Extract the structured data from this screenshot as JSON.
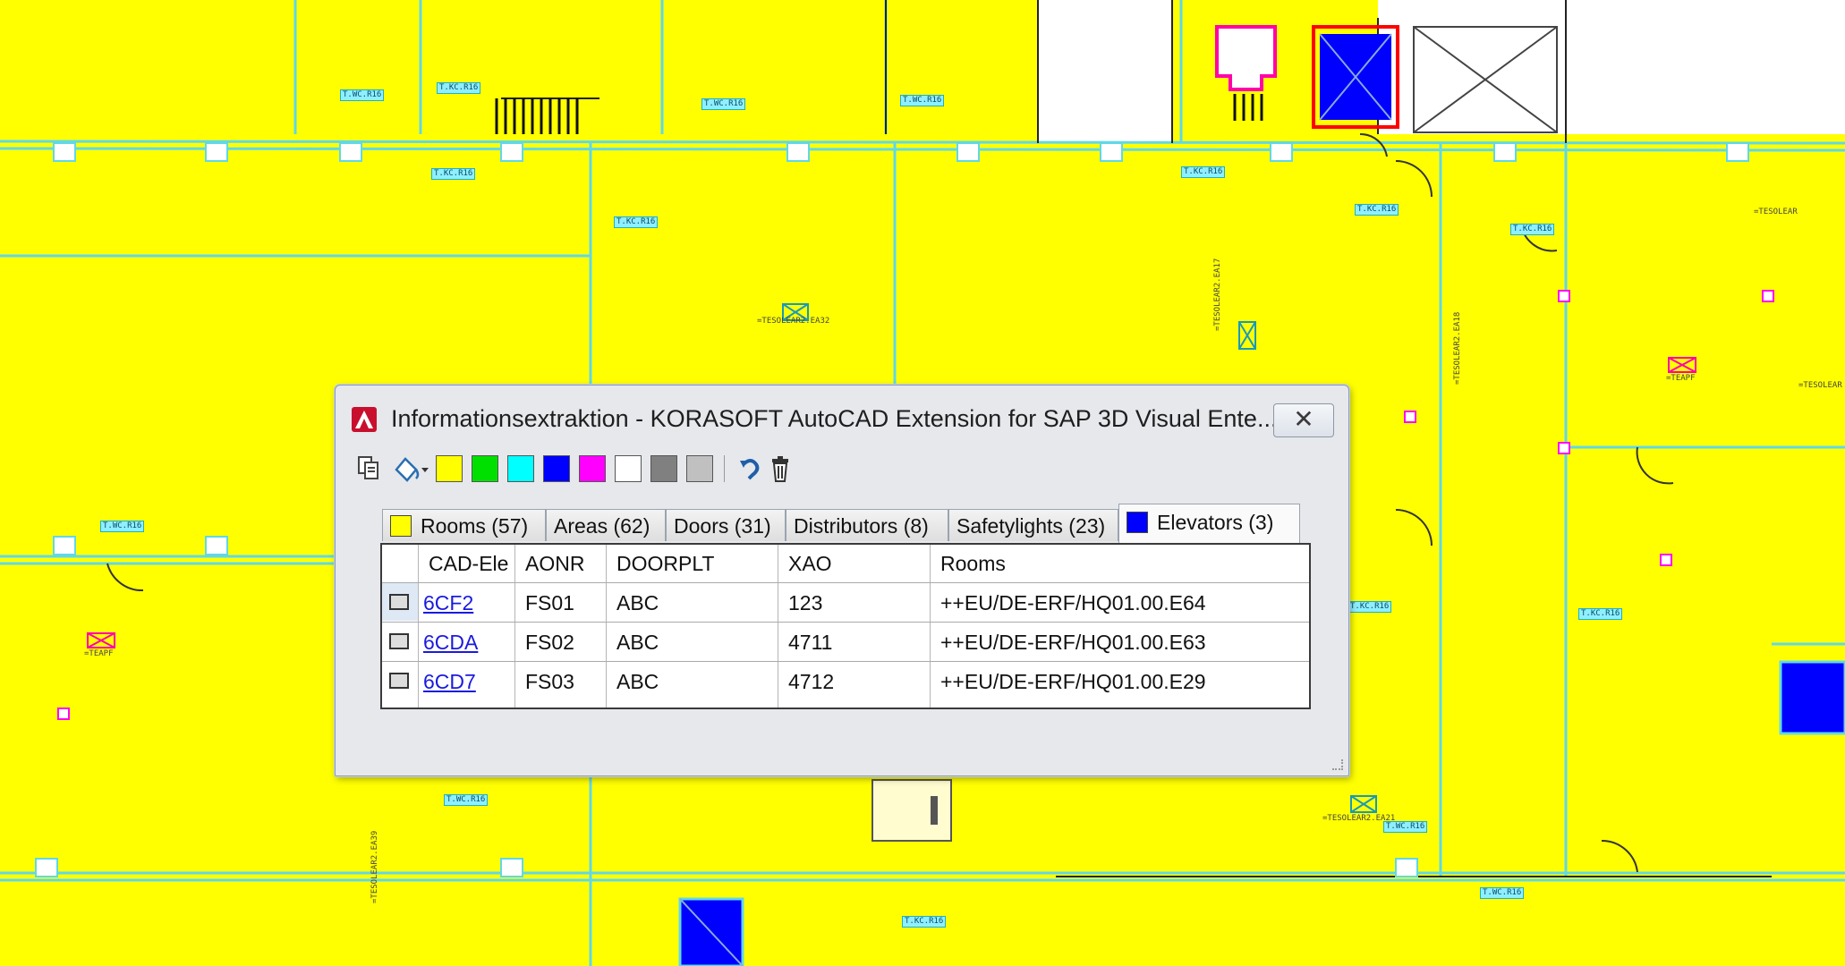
{
  "floorplan": {
    "labels": [
      "T.WC.R16",
      "T.KC.R16",
      "T.WC.R16",
      "T.WC.R16",
      "T.KC.R16",
      "T.KC.R16",
      "T.KC.R16",
      "T.KC.R16",
      "T.KC.R16",
      "T.WC.R16",
      "T.WC.R16",
      "T.WC.R16",
      "T.KC.R16",
      "T.KC.R16",
      "T.KC.R16",
      "T.WC.R16"
    ],
    "vertical_texts": [
      "=TESOLEAR2.EA32",
      "=TESOLEAR2.EA17",
      "=TESOLEAR2.EA18",
      "=TESOLEAR",
      "=TEAPF",
      "=TESOLEAR",
      "=TEAPF",
      "=TESOLEAR2.EA21",
      "=TESOLEAR2.EA39"
    ]
  },
  "dialog": {
    "title": "Informationsextraktion - KORASOFT AutoCAD Extension for SAP 3D Visual Ente...",
    "close_label": "✕",
    "toolbar": {
      "swatches": [
        "#ffff00",
        "#00e000",
        "#00ffff",
        "#0000ff",
        "#ff00ff",
        "#ffffff",
        "#808080",
        "#c0c0c0"
      ]
    },
    "tabs": [
      {
        "label": "Rooms (57)",
        "swatch": "#ffff00"
      },
      {
        "label": "Areas (62)"
      },
      {
        "label": "Doors (31)"
      },
      {
        "label": "Distributors (8)"
      },
      {
        "label": "Safetylights (23)"
      },
      {
        "label": "Elevators (3)",
        "swatch": "#0000ff",
        "active": true
      }
    ],
    "grid": {
      "columns": [
        "CAD-Ele",
        "AONR",
        "DOORPLT",
        "XAO",
        "Rooms"
      ],
      "rows": [
        {
          "cad": "6CF2",
          "aonr": "FS01",
          "doorplt": "ABC",
          "xao": "123",
          "rooms": "++EU/DE-ERF/HQ01.00.E64"
        },
        {
          "cad": "6CDA",
          "aonr": "FS02",
          "doorplt": "ABC",
          "xao": "4711",
          "rooms": "++EU/DE-ERF/HQ01.00.E63"
        },
        {
          "cad": "6CD7",
          "aonr": "FS03",
          "doorplt": "ABC",
          "xao": "4712",
          "rooms": "++EU/DE-ERF/HQ01.00.E29"
        }
      ]
    }
  }
}
